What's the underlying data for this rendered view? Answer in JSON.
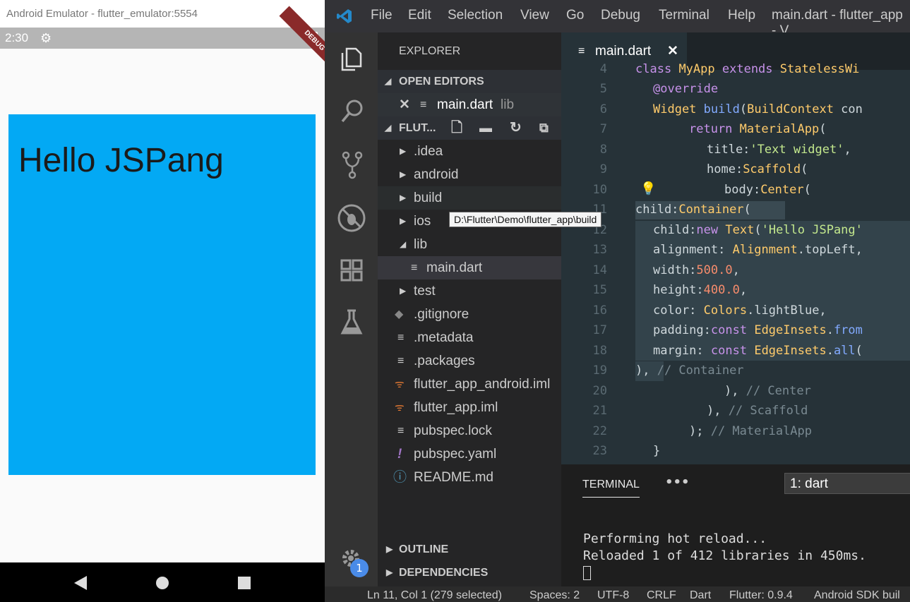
{
  "emulator": {
    "title": "Android Emulator - flutter_emulator:5554",
    "time": "2:30",
    "debug_label": "DEBUG",
    "app_text": "Hello JSPang",
    "colors": {
      "container": "#03a9f4"
    }
  },
  "menu": [
    "File",
    "Edit",
    "Selection",
    "View",
    "Go",
    "Debug",
    "Terminal",
    "Help"
  ],
  "window_title": "main.dart - flutter_app - V",
  "sidebar": {
    "title": "EXPLORER",
    "open_editors": "OPEN EDITORS",
    "open_file": "main.dart",
    "open_file_path": "lib",
    "folder": "FLUT...",
    "tree": [
      ".idea",
      "android",
      "build",
      "ios",
      "lib",
      "main.dart",
      "test",
      ".gitignore",
      ".metadata",
      ".packages",
      "flutter_app_android.iml",
      "flutter_app.iml",
      "pubspec.lock",
      "pubspec.yaml",
      "README.md"
    ],
    "outline": "OUTLINE",
    "dependencies": "DEPENDENCIES",
    "tooltip": "D:\\Flutter\\Demo\\flutter_app\\build",
    "badge": "1"
  },
  "tab": {
    "label": "main.dart"
  },
  "line_numbers": [
    "4",
    "5",
    "6",
    "7",
    "8",
    "9",
    "10",
    "11",
    "12",
    "13",
    "14",
    "15",
    "16",
    "17",
    "18",
    "19",
    "20",
    "21",
    "22",
    "23"
  ],
  "terminal": {
    "tab": "TERMINAL",
    "dropdown": "1: dart",
    "line1": "Performing hot reload...",
    "line2": "Reloaded 1 of 412 libraries in 450ms."
  },
  "statusbar": {
    "position": "Ln 11, Col 1 (279 selected)",
    "spaces": "Spaces: 2",
    "encoding": "UTF-8",
    "eol": "CRLF",
    "language": "Dart",
    "flutter": "Flutter: 0.9.4",
    "sdk": "Android SDK buil"
  }
}
